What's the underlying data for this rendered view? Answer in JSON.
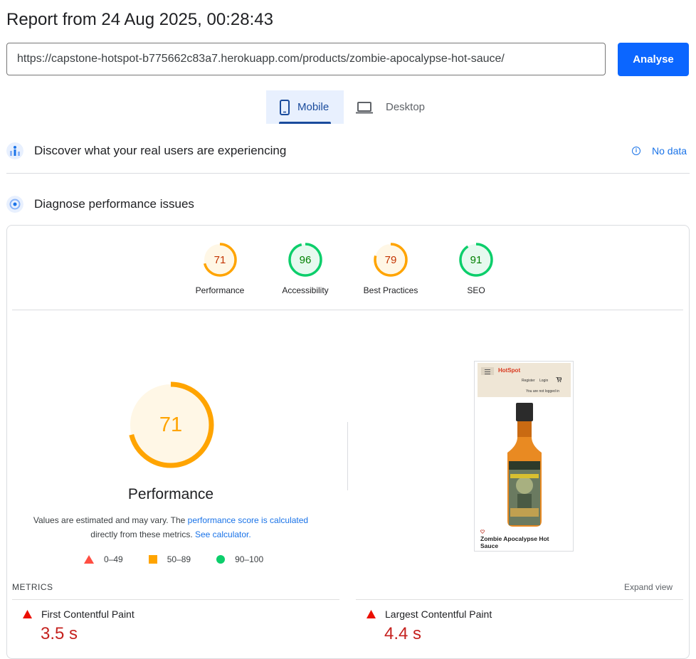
{
  "header": {
    "title": "Report from 24 Aug 2025, 00:28:43"
  },
  "url_input": {
    "value": "https://capstone-hotspot-b775662c83a7.herokuapp.com/products/zombie-apocalypse-hot-sauce/"
  },
  "analyse_button": "Analyse",
  "tabs": {
    "mobile": "Mobile",
    "desktop": "Desktop"
  },
  "field_data": {
    "heading": "Discover what your real users are experiencing",
    "status": "No data"
  },
  "lab_data": {
    "heading": "Diagnose performance issues"
  },
  "scores": [
    {
      "label": "Performance",
      "value": "71",
      "status": "average",
      "color": "#ffa400"
    },
    {
      "label": "Accessibility",
      "value": "96",
      "status": "pass",
      "color": "#0cce6b"
    },
    {
      "label": "Best Practices",
      "value": "79",
      "status": "average",
      "color": "#ffa400"
    },
    {
      "label": "SEO",
      "value": "91",
      "status": "pass",
      "color": "#0cce6b"
    }
  ],
  "performance": {
    "score": "71",
    "title": "Performance",
    "desc_prefix": "Values are estimated and may vary. The ",
    "desc_link1": "performance score is calculated",
    "desc_mid": "directly from these metrics.",
    "desc_link2": "See calculator."
  },
  "legend": [
    {
      "range": "0–49",
      "shape": "triangle",
      "color": "#ff4e42"
    },
    {
      "range": "50–89",
      "shape": "square",
      "color": "#ffa400"
    },
    {
      "range": "90–100",
      "shape": "circle",
      "color": "#0cce6b"
    }
  ],
  "screenshot": {
    "brand": "HotSpot",
    "register": "Register",
    "login": "Login",
    "not_logged": "You are not logged in",
    "product_title": "Zombie Apocalypse Hot Sauce"
  },
  "metrics": {
    "label": "METRICS",
    "expand": "Expand view",
    "items": [
      {
        "name": "First Contentful Paint",
        "value": "3.5 s"
      },
      {
        "name": "Largest Contentful Paint",
        "value": "4.4 s"
      }
    ]
  }
}
